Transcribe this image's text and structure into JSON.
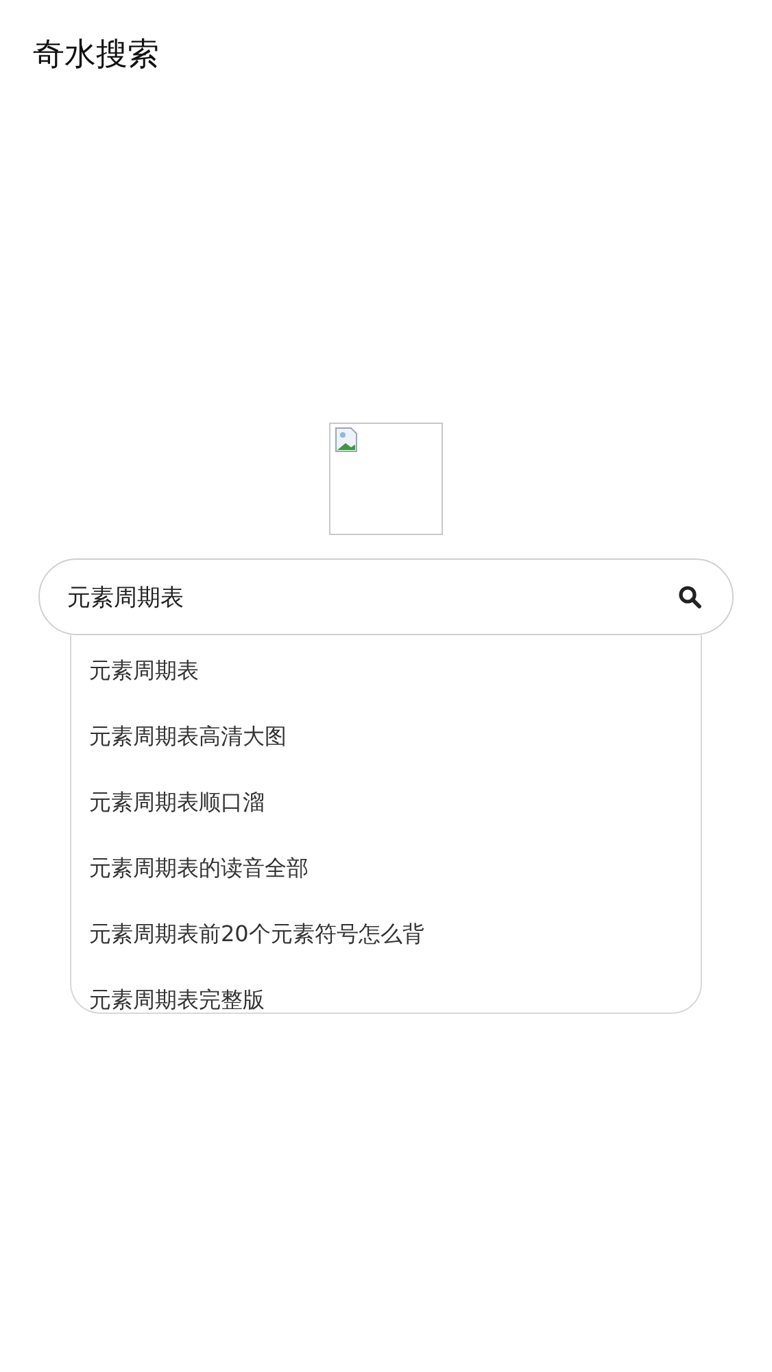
{
  "header": {
    "title": "奇水搜索"
  },
  "search": {
    "value": "元素周期表"
  },
  "suggestions": [
    {
      "text": "元素周期表"
    },
    {
      "text": "元素周期表高清大图"
    },
    {
      "text": "元素周期表顺口溜"
    },
    {
      "text": "元素周期表的读音全部"
    },
    {
      "text": "元素周期表前20个元素符号怎么背"
    },
    {
      "text": "元素周期表完整版"
    }
  ]
}
